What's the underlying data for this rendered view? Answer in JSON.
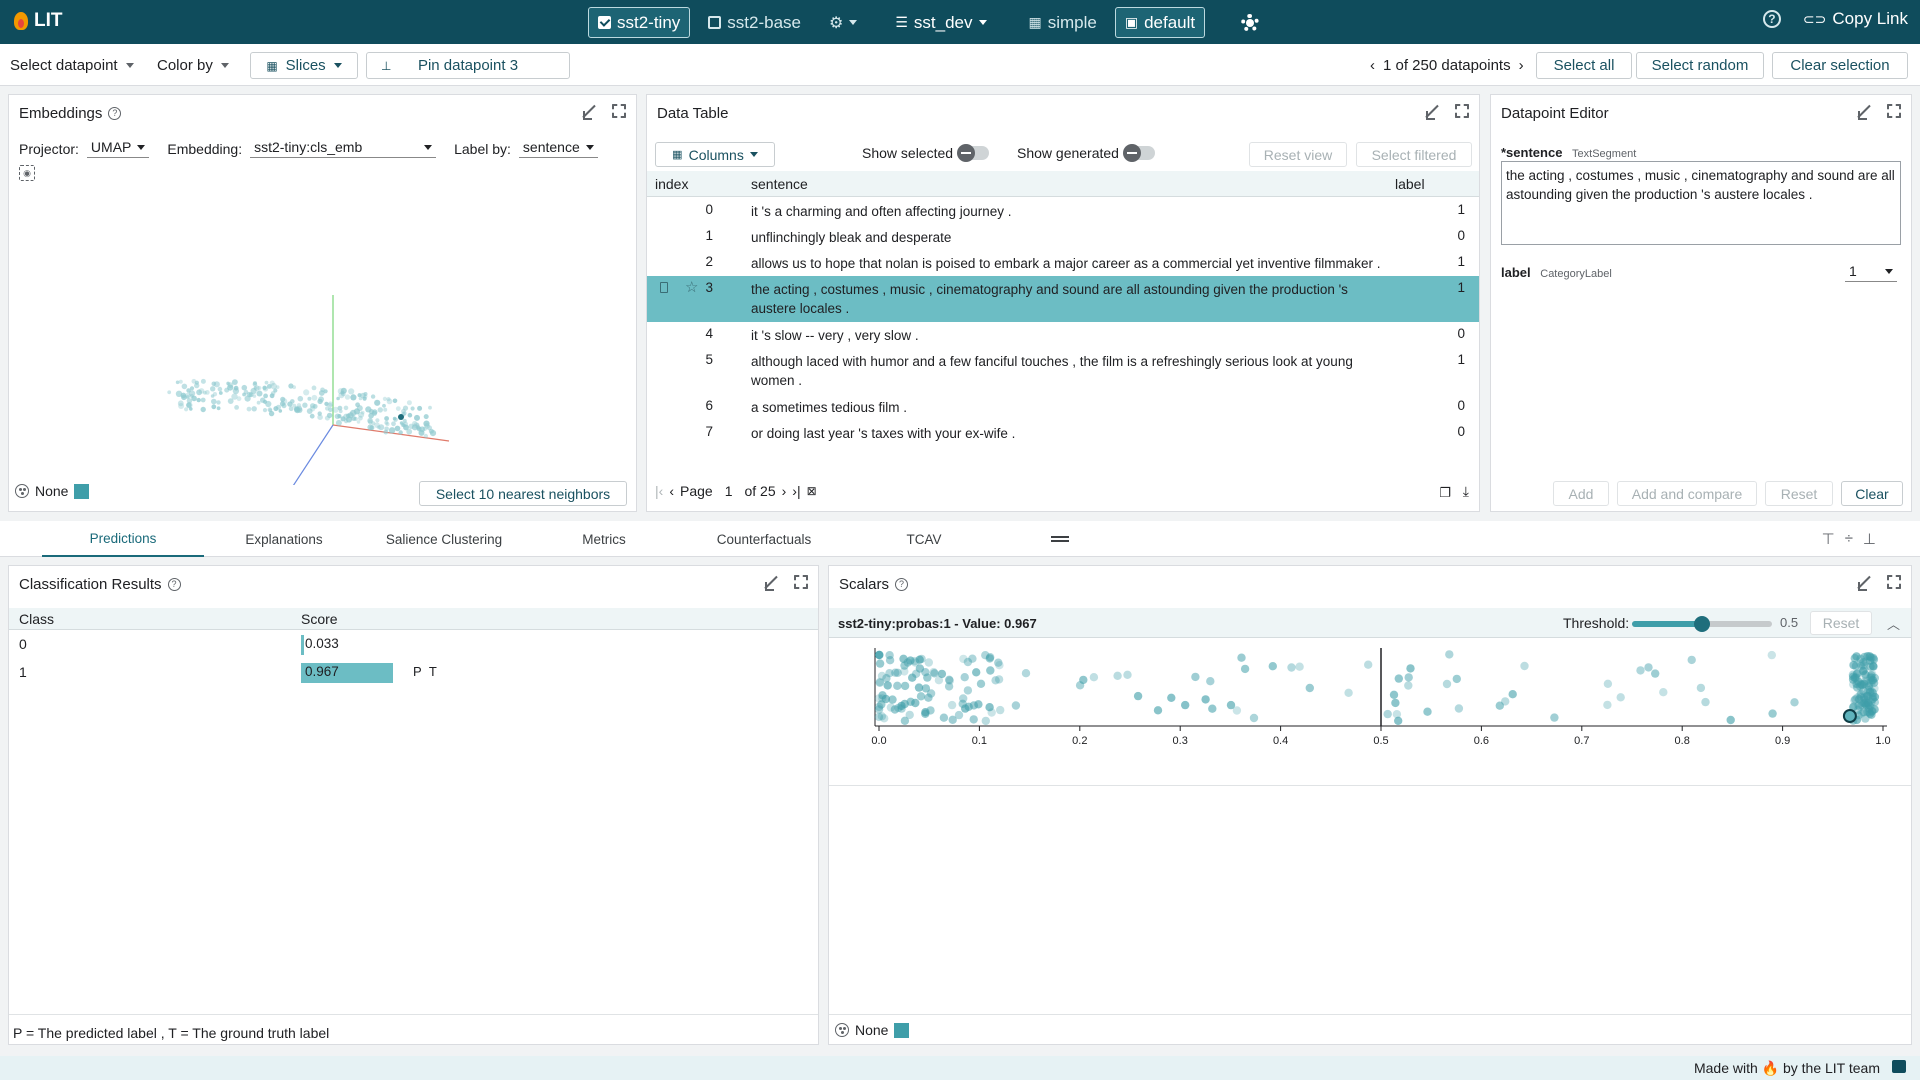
{
  "app": {
    "title": "LIT"
  },
  "models": [
    {
      "label": "sst2-tiny",
      "checked": true
    },
    {
      "label": "sst2-base",
      "checked": false
    }
  ],
  "dataset": {
    "label": "sst_dev"
  },
  "layouts": [
    {
      "label": "simple",
      "active": false
    },
    {
      "label": "default",
      "active": true
    }
  ],
  "header_right": {
    "copy_link": "Copy Link"
  },
  "toolbar": {
    "select_datapoint": "Select datapoint",
    "color_by": "Color by",
    "slices": "Slices",
    "pin": "Pin datapoint 3",
    "nav": "1 of 250 datapoints",
    "select_all": "Select all",
    "select_random": "Select random",
    "clear_selection": "Clear selection"
  },
  "embeddings": {
    "title": "Embeddings",
    "projector_label": "Projector:",
    "projector": "UMAP",
    "embedding_label": "Embedding:",
    "embedding": "sst2-tiny:cls_emb",
    "labelby_label": "Label by:",
    "labelby": "sentence",
    "color_label": "None",
    "nearest_button": "Select 10 nearest neighbors"
  },
  "data_table": {
    "title": "Data Table",
    "columns_button": "Columns",
    "show_selected": "Show selected",
    "show_generated": "Show generated",
    "reset_view": "Reset view",
    "select_filtered": "Select filtered",
    "headers": [
      "index",
      "sentence",
      "label"
    ],
    "rows": [
      {
        "index": "0",
        "sentence": "it 's a charming and often affecting journey .",
        "label": "1"
      },
      {
        "index": "1",
        "sentence": "unflinchingly bleak and desperate",
        "label": "0"
      },
      {
        "index": "2",
        "sentence": "allows us to hope that nolan is poised to embark a major career as a commercial yet inventive filmmaker .",
        "label": "1"
      },
      {
        "index": "3",
        "sentence": "the acting , costumes , music , cinematography and sound are all astounding given the production 's austere locales .",
        "label": "1"
      },
      {
        "index": "4",
        "sentence": "it 's slow -- very , very slow .",
        "label": "0"
      },
      {
        "index": "5",
        "sentence": "although laced with humor and a few fanciful touches , the film is a refreshingly serious look at young women .",
        "label": "1"
      },
      {
        "index": "6",
        "sentence": "a sometimes tedious film .",
        "label": "0"
      },
      {
        "index": "7",
        "sentence": "or doing last year 's taxes with your ex-wife .",
        "label": "0"
      }
    ],
    "selected_row": 3,
    "page_label": "Page",
    "page": "1",
    "page_total": "of 25"
  },
  "editor": {
    "title": "Datapoint Editor",
    "sentence_field": "*sentence",
    "sentence_type": "TextSegment",
    "sentence_value": "the acting , costumes , music , cinematography and sound are all astounding given the production 's austere locales .",
    "label_field": "label",
    "label_type": "CategoryLabel",
    "label_value": "1",
    "add": "Add",
    "add_compare": "Add and compare",
    "reset": "Reset",
    "clear": "Clear"
  },
  "tabs": [
    "Predictions",
    "Explanations",
    "Salience Clustering",
    "Metrics",
    "Counterfactuals",
    "TCAV"
  ],
  "active_tab": 0,
  "classification": {
    "title": "Classification Results",
    "headers": [
      "Class",
      "Score"
    ],
    "rows": [
      {
        "class": "0",
        "score": 0.033,
        "score_text": "0.033",
        "tags": ""
      },
      {
        "class": "1",
        "score": 0.967,
        "score_text": "0.967",
        "tags": "P T"
      }
    ],
    "legend": "P = The predicted label , T = The ground truth label"
  },
  "scalars": {
    "title": "Scalars",
    "plot_title": "sst2-tiny:probas:1 - Value: 0.967",
    "threshold_label": "Threshold:",
    "threshold_value": 0.5,
    "threshold_text": "0.5",
    "reset": "Reset",
    "color_label": "None",
    "ticks": [
      "0.0",
      "0.1",
      "0.2",
      "0.3",
      "0.4",
      "0.5",
      "0.6",
      "0.7",
      "0.8",
      "0.9",
      "1.0"
    ],
    "selected_value": 0.967
  },
  "footer": {
    "text": "Made with 🔥 by the LIT team"
  },
  "colors": {
    "primary": "#0f4c5c",
    "accent": "#3f9ea9",
    "selected_row": "#6cbdc4"
  }
}
